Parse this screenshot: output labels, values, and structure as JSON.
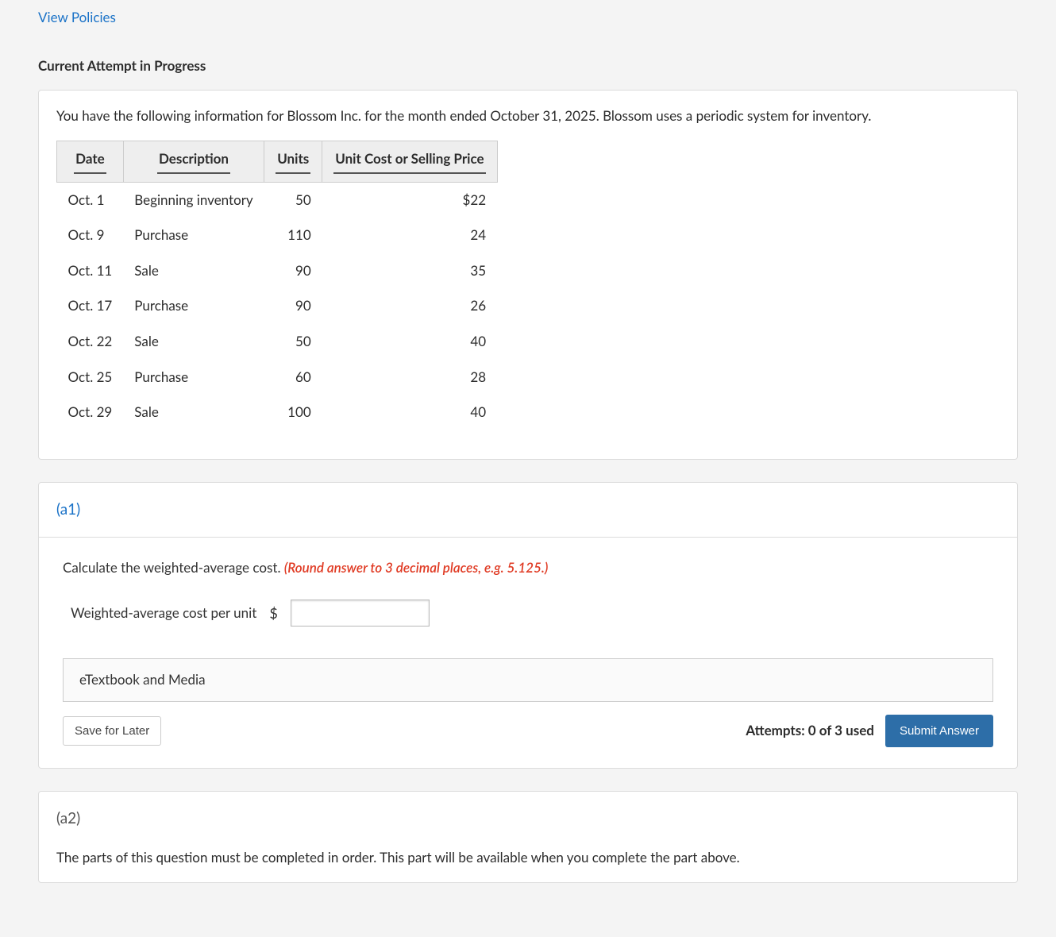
{
  "links": {
    "view_policies": "View Policies"
  },
  "section_title": "Current Attempt in Progress",
  "problem": {
    "intro": "You have the following information for Blossom Inc. for the month ended October 31, 2025. Blossom uses a periodic system for inventory.",
    "headers": {
      "date": "Date",
      "desc": "Description",
      "units": "Units",
      "price": "Unit Cost or Selling Price"
    },
    "rows": [
      {
        "date": "Oct. 1",
        "desc": "Beginning inventory",
        "units": "50",
        "price": "$22"
      },
      {
        "date": "Oct. 9",
        "desc": "Purchase",
        "units": "110",
        "price": "24"
      },
      {
        "date": "Oct. 11",
        "desc": "Sale",
        "units": "90",
        "price": "35"
      },
      {
        "date": "Oct. 17",
        "desc": "Purchase",
        "units": "90",
        "price": "26"
      },
      {
        "date": "Oct. 22",
        "desc": "Sale",
        "units": "50",
        "price": "40"
      },
      {
        "date": "Oct. 25",
        "desc": "Purchase",
        "units": "60",
        "price": "28"
      },
      {
        "date": "Oct. 29",
        "desc": "Sale",
        "units": "100",
        "price": "40"
      }
    ]
  },
  "part_a1": {
    "label": "(a1)",
    "instruction_text": "Calculate the weighted-average cost. ",
    "instruction_hint": "(Round answer to 3 decimal places, e.g. 5.125.)",
    "answer_label": "Weighted-average cost per unit",
    "currency": "$",
    "resource_label": "eTextbook and Media",
    "save_label": "Save for Later",
    "attempts_label": "Attempts: 0 of 3 used",
    "submit_label": "Submit Answer"
  },
  "part_a2": {
    "label": "(a2)",
    "locked_text": "The parts of this question must be completed in order. This part will be available when you complete the part above."
  }
}
